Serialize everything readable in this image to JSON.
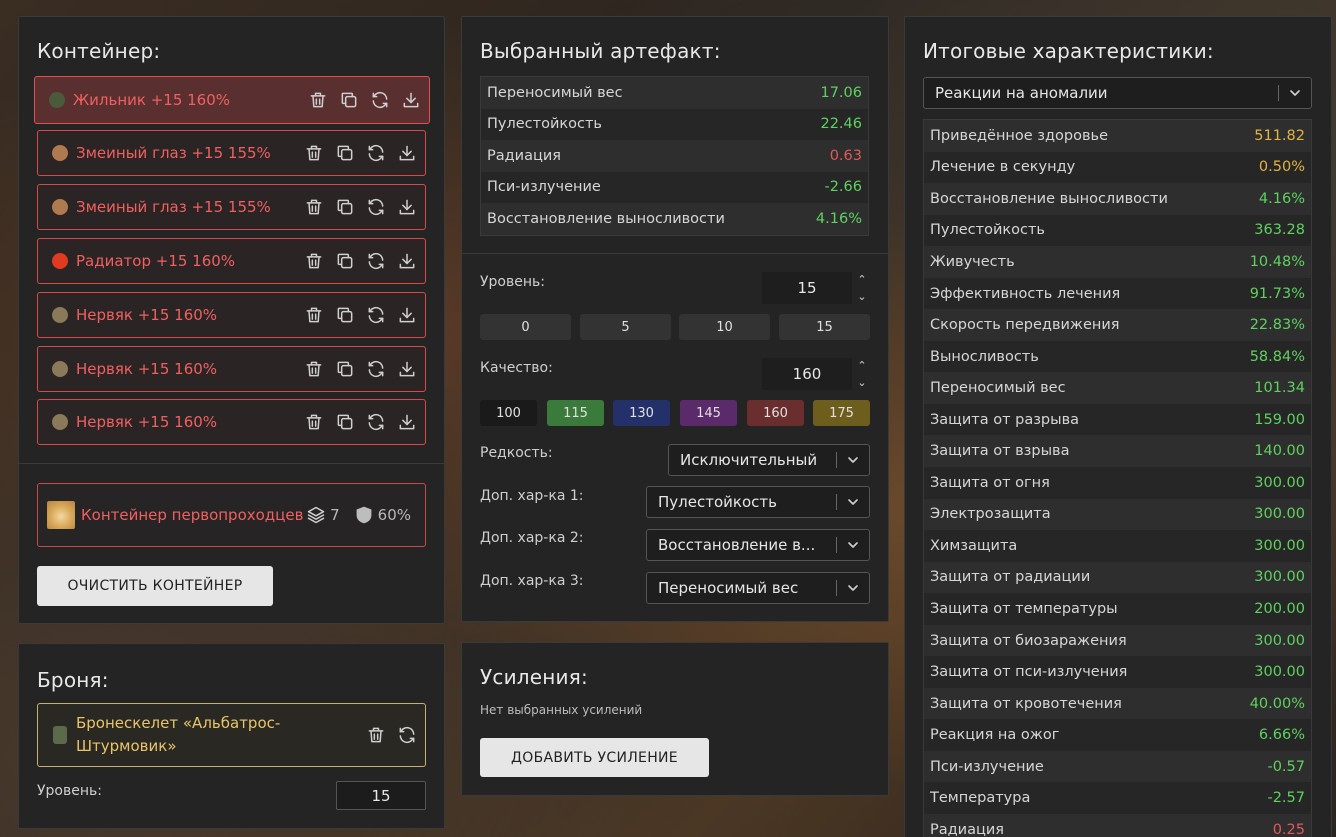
{
  "container": {
    "title": "Контейнер:",
    "artifacts": [
      {
        "name": "Жильник +15 160%",
        "color": "#4a5a3a"
      },
      {
        "name": "Змеиный глаз +15 155%",
        "color": "#b07a50"
      },
      {
        "name": "Змеиный глаз +15 155%",
        "color": "#b07a50"
      },
      {
        "name": "Радиатор +15 160%",
        "color": "#e03a20"
      },
      {
        "name": "Нервяк +15 160%",
        "color": "#8a7a5a"
      },
      {
        "name": "Нервяк +15 160%",
        "color": "#8a7a5a"
      },
      {
        "name": "Нервяк +15 160%",
        "color": "#8a7a5a"
      }
    ],
    "container_name": "Контейнер первопроходцев",
    "slots": "7",
    "protection": "60%",
    "clear_label": "ОЧИСТИТЬ КОНТЕЙНЕР"
  },
  "armor": {
    "title": "Броня:",
    "name": "Бронескелет «Альбатрос-Штурмовик»",
    "level_label": "Уровень:",
    "level_value": "15"
  },
  "artifact": {
    "title": "Выбранный артефакт:",
    "stats": [
      {
        "label": "Переносимый вес",
        "value": "17.06",
        "tone": "green"
      },
      {
        "label": "Пулестойкость",
        "value": "22.46",
        "tone": "green"
      },
      {
        "label": "Радиация",
        "value": "0.63",
        "tone": "red"
      },
      {
        "label": "Пси-излучение",
        "value": "-2.66",
        "tone": "green"
      },
      {
        "label": "Восстановление выносливости",
        "value": "4.16%",
        "tone": "green"
      }
    ],
    "level_label": "Уровень:",
    "level_value": "15",
    "level_presets": [
      "0",
      "5",
      "10",
      "15"
    ],
    "quality_label": "Качество:",
    "quality_value": "160",
    "quality_presets": [
      {
        "label": "100",
        "color": "#1a1a1a"
      },
      {
        "label": "115",
        "color": "#3a7a3a"
      },
      {
        "label": "130",
        "color": "#24306a"
      },
      {
        "label": "145",
        "color": "#5a2a6a"
      },
      {
        "label": "160",
        "color": "#6a2e2e"
      },
      {
        "label": "175",
        "color": "#6e5e1e"
      }
    ],
    "rarity_label": "Редкость:",
    "rarity_value": "Исключительный",
    "extra1_label": "Доп. хар-ка 1:",
    "extra1_value": "Пулестойкость",
    "extra2_label": "Доп. хар-ка 2:",
    "extra2_value": "Восстановление в...",
    "extra3_label": "Доп. хар-ка 3:",
    "extra3_value": "Переносимый вес"
  },
  "boosts": {
    "title": "Усиления:",
    "empty": "Нет выбранных усилений",
    "add_label": "ДОБАВИТЬ УСИЛЕНИЕ"
  },
  "totals": {
    "title": "Итоговые характеристики:",
    "filter_value": "Реакции на аномалии",
    "stats": [
      {
        "label": "Приведённое здоровье",
        "value": "511.82",
        "tone": "yellow"
      },
      {
        "label": "Лечение в секунду",
        "value": "0.50%",
        "tone": "yellow"
      },
      {
        "label": "Восстановление выносливости",
        "value": "4.16%",
        "tone": "green"
      },
      {
        "label": "Пулестойкость",
        "value": "363.28",
        "tone": "green"
      },
      {
        "label": "Живучесть",
        "value": "10.48%",
        "tone": "green"
      },
      {
        "label": "Эффективность лечения",
        "value": "91.73%",
        "tone": "green"
      },
      {
        "label": "Скорость передвижения",
        "value": "22.83%",
        "tone": "green"
      },
      {
        "label": "Выносливость",
        "value": "58.84%",
        "tone": "green"
      },
      {
        "label": "Переносимый вес",
        "value": "101.34",
        "tone": "green"
      },
      {
        "label": "Защита от разрыва",
        "value": "159.00",
        "tone": "green"
      },
      {
        "label": "Защита от взрыва",
        "value": "140.00",
        "tone": "green"
      },
      {
        "label": "Защита от огня",
        "value": "300.00",
        "tone": "green"
      },
      {
        "label": "Электрозащита",
        "value": "300.00",
        "tone": "green"
      },
      {
        "label": "Химзащита",
        "value": "300.00",
        "tone": "green"
      },
      {
        "label": "Защита от радиации",
        "value": "300.00",
        "tone": "green"
      },
      {
        "label": "Защита от температуры",
        "value": "200.00",
        "tone": "green"
      },
      {
        "label": "Защита от биозаражения",
        "value": "300.00",
        "tone": "green"
      },
      {
        "label": "Защита от пси-излучения",
        "value": "300.00",
        "tone": "green"
      },
      {
        "label": "Защита от кровотечения",
        "value": "40.00%",
        "tone": "green"
      },
      {
        "label": "Реакция на ожог",
        "value": "6.66%",
        "tone": "green"
      },
      {
        "label": "Пси-излучение",
        "value": "-0.57",
        "tone": "green"
      },
      {
        "label": "Температура",
        "value": "-2.57",
        "tone": "green"
      },
      {
        "label": "Радиация",
        "value": "0.25",
        "tone": "red"
      }
    ]
  }
}
